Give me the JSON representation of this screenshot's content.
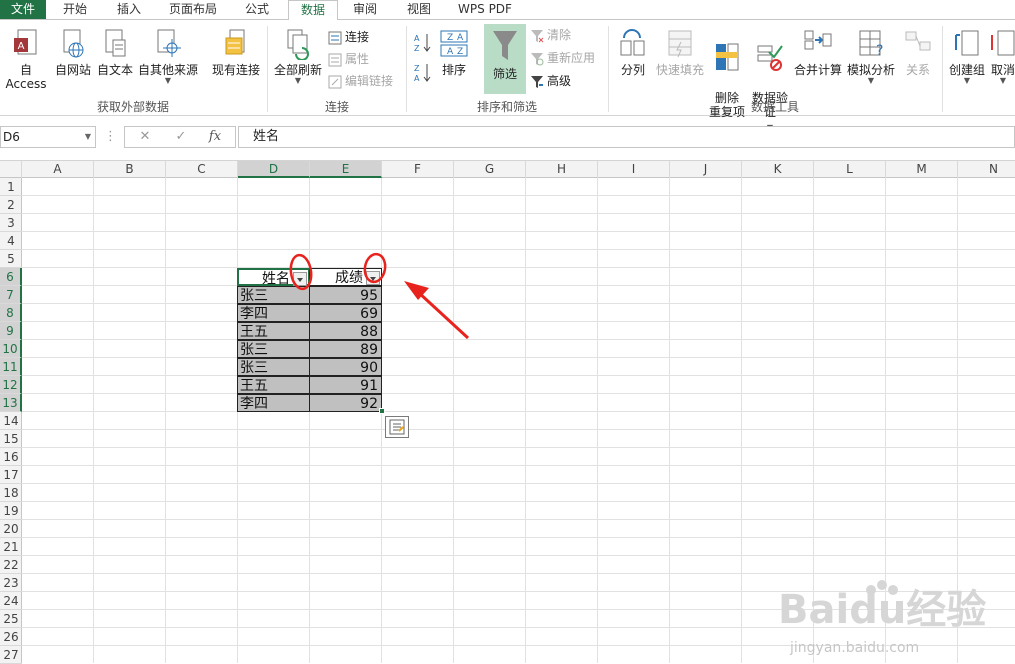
{
  "menu": {
    "items": [
      "文件",
      "开始",
      "插入",
      "页面布局",
      "公式",
      "数据",
      "审阅",
      "视图",
      "WPS PDF"
    ],
    "active_index": 5
  },
  "ribbon": {
    "external_data": {
      "buttons": [
        "自 Access",
        "自网站",
        "自文本",
        "自其他来源",
        "现有连接"
      ],
      "label": "获取外部数据"
    },
    "connections": {
      "refresh_all": "全部刷新",
      "small": [
        "连接",
        "属性",
        "编辑链接"
      ],
      "label": "连接"
    },
    "sort_filter": {
      "sort": "排序",
      "filter": "筛选",
      "small": [
        "清除",
        "重新应用",
        "高级"
      ],
      "label": "排序和筛选"
    },
    "data_tools": {
      "buttons": [
        "分列",
        "快速填充",
        "删除\n重复项",
        "数据验\n证",
        "合并计算",
        "模拟分析",
        "关系"
      ],
      "label": "数据工具"
    },
    "outline": {
      "buttons": [
        "创建组",
        "取消"
      ]
    }
  },
  "formula_bar": {
    "name_box": "D6",
    "cancel_icon": "✕",
    "enter_icon": "✓",
    "fx": "fx",
    "value": "姓名"
  },
  "grid": {
    "columns": [
      "A",
      "B",
      "C",
      "D",
      "E",
      "F",
      "G",
      "H",
      "I",
      "J",
      "K",
      "L",
      "M",
      "N"
    ],
    "rows": [
      "1",
      "2",
      "3",
      "4",
      "5",
      "6",
      "7",
      "8",
      "9",
      "10",
      "11",
      "12",
      "13",
      "14",
      "15",
      "16",
      "17",
      "18",
      "19",
      "20",
      "21",
      "22",
      "23",
      "24",
      "25",
      "26",
      "27"
    ],
    "selected_columns": [
      "D",
      "E"
    ],
    "selected_rows": [
      "6",
      "7",
      "8",
      "9",
      "10",
      "11",
      "12",
      "13"
    ]
  },
  "table": {
    "headers": [
      "姓名",
      "成绩"
    ],
    "rows": [
      [
        "张三",
        "95"
      ],
      [
        "李四",
        "69"
      ],
      [
        "王五",
        "88"
      ],
      [
        "张三",
        "89"
      ],
      [
        "张三",
        "90"
      ],
      [
        "王五",
        "91"
      ],
      [
        "李四",
        "92"
      ]
    ]
  },
  "watermark": {
    "brand": "Baidu经验",
    "url": "jingyan.baidu.com"
  },
  "colors": {
    "excel_green": "#217346",
    "annotation_red": "#e8231e",
    "filter_active": "#b9dcc6"
  }
}
